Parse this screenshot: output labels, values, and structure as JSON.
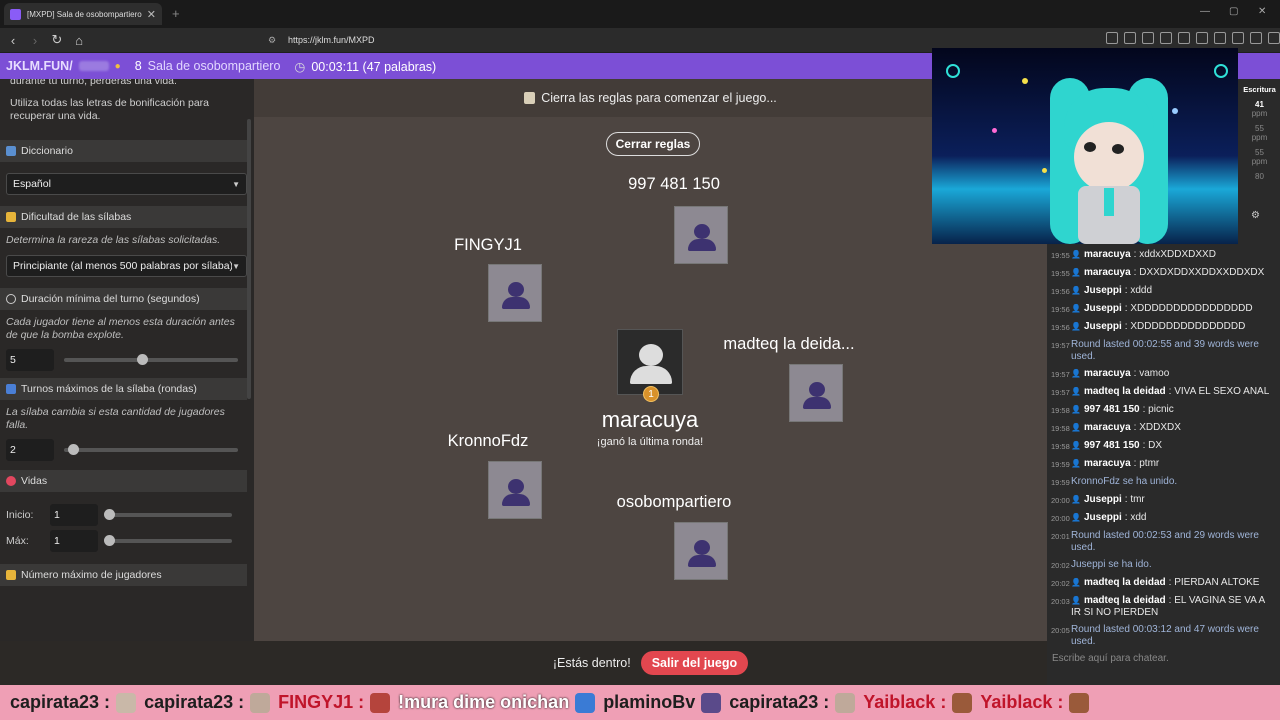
{
  "browser": {
    "tab_title": "[MXPD] Sala de osobompartiero",
    "url": "https://jklm.fun/MXPD"
  },
  "header": {
    "brand": "JKLM.FUN/",
    "player_count": "8",
    "room_name": "Sala de osobompartiero",
    "timer": "00:03:11 (47 palabras)"
  },
  "settings": {
    "intro_line": "durante tu turno, perderás una vida.",
    "bonus_text": "Utiliza todas las letras de bonificación para recuperar una vida.",
    "dictionary": {
      "label": "Diccionario",
      "value": "Español"
    },
    "difficulty": {
      "label": "Dificultad de las sílabas",
      "desc": "Determina la rareza de las sílabas solicitadas.",
      "value": "Principiante (al menos 500 palabras por sílaba)"
    },
    "min_turn": {
      "label": "Duración mínima del turno (segundos)",
      "desc": "Cada jugador tiene al menos esta duración antes de que la bomba explote.",
      "value": "5",
      "fraction": 0.45
    },
    "max_turns": {
      "label": "Turnos máximos de la sílaba (rondas)",
      "desc": "La sílaba cambia si esta cantidad de jugadores falla.",
      "value": "2",
      "fraction": 0.05
    },
    "lives": {
      "label": "Vidas",
      "start_label": "Inicio:",
      "start_value": "1",
      "max_label": "Máx:",
      "max_value": "1"
    },
    "max_players": {
      "label": "Número máximo de jugadores"
    }
  },
  "game": {
    "notice": "Cierra las reglas para comenzar el juego...",
    "close_rules": "Cerrar reglas",
    "players": [
      "997 481 150",
      "FINGYJ1",
      "madteq la deida...",
      "KronnoFdz",
      "osobompartiero"
    ],
    "winner": {
      "name": "maracuya",
      "subtitle": "¡ganó la última ronda!",
      "medal": "1"
    },
    "inside_text": "¡Estás dentro!",
    "leave_button": "Salir del juego"
  },
  "wpm": {
    "header": "Escritura",
    "values": [
      "41",
      "ppm",
      "55",
      "ppm",
      "55",
      "ppm",
      "80"
    ]
  },
  "chat": {
    "messages": [
      {
        "time": "19:55",
        "user": "maracuya",
        "text": "xddxXDDXDXXD"
      },
      {
        "time": "19:55",
        "user": "maracuya",
        "text": "DXXDXDDXXDDXXDDXDX"
      },
      {
        "time": "19:56",
        "user": "Juseppi",
        "text": "xddd"
      },
      {
        "time": "19:56",
        "user": "Juseppi",
        "text": "XDDDDDDDDDDDDDDDD"
      },
      {
        "time": "19:56",
        "user": "Juseppi",
        "text": "XDDDDDDDDDDDDDDD"
      },
      {
        "time": "19:57",
        "user": "",
        "text": "Round lasted 00:02:55 and 39 words were used."
      },
      {
        "time": "19:57",
        "user": "maracuya",
        "text": "vamoo"
      },
      {
        "time": "19:57",
        "user": "madteq la deidad",
        "text": "VIVA EL SEXO ANAL"
      },
      {
        "time": "19:58",
        "user": "997 481 150",
        "text": "picnic"
      },
      {
        "time": "19:58",
        "user": "maracuya",
        "text": "XDDXDX"
      },
      {
        "time": "19:58",
        "user": "997 481 150",
        "text": "DX"
      },
      {
        "time": "19:59",
        "user": "maracuya",
        "text": "ptmr"
      },
      {
        "time": "19:59",
        "user": "",
        "text": "KronnoFdz se ha unido."
      },
      {
        "time": "20:00",
        "user": "Juseppi",
        "text": "tmr"
      },
      {
        "time": "20:00",
        "user": "Juseppi",
        "text": "xdd"
      },
      {
        "time": "20:01",
        "user": "",
        "text": "Round lasted 00:02:53 and 29 words were used."
      },
      {
        "time": "20:02",
        "user": "",
        "text": "Juseppi se ha ido."
      },
      {
        "time": "20:02",
        "user": "madteq la deidad",
        "text": "PIERDAN ALTOKE"
      },
      {
        "time": "20:03",
        "user": "madteq la deidad",
        "text": "EL VAGINA SE VA A IR SI NO PIERDEN"
      },
      {
        "time": "20:05",
        "user": "",
        "text": "Round lasted 00:03:12 and 47 words were used."
      }
    ],
    "input_placeholder": "Escribe aquí para chatear."
  },
  "ticker": [
    {
      "text": "capirata23 :",
      "style": "dark"
    },
    {
      "text": "capirata23 :",
      "style": "dark"
    },
    {
      "text": "FINGYJ1 :",
      "style": "red"
    },
    {
      "text": "!mura dime onichan",
      "style": "mura"
    },
    {
      "text": "plaminoBv",
      "style": "dark"
    },
    {
      "text": "capirata23 :",
      "style": "dark"
    },
    {
      "text": "Yaiblack :",
      "style": "red"
    },
    {
      "text": "Yaiblack :",
      "style": "red"
    }
  ]
}
